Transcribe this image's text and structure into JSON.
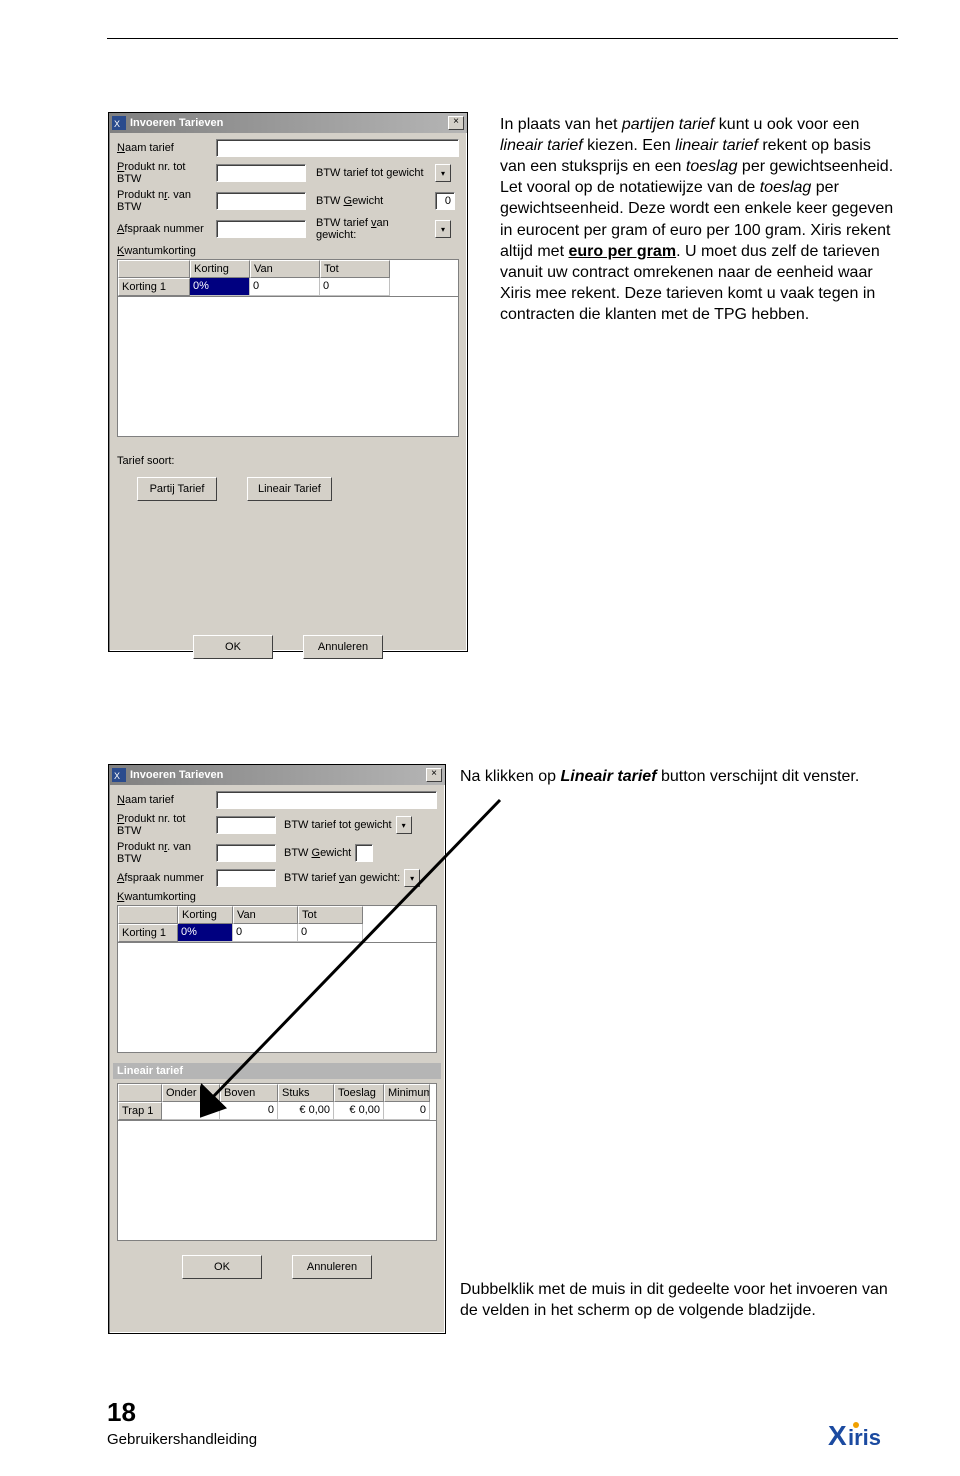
{
  "page": {
    "number": "18",
    "footer": "Gebruikershandleiding"
  },
  "paragraphs": {
    "p1_a": "In plaats van het ",
    "p1_b": "partijen tarief",
    "p1_c": " kunt u ook voor een ",
    "p1_d": "lineair tarief",
    "p1_e": " kiezen. Een ",
    "p1_f": "lineair tarief",
    "p1_g": " rekent op basis van een stuksprijs en een ",
    "p1_h": "toeslag",
    "p1_i": " per gewichtseenheid. Let vooral op de notatiewijze van de ",
    "p1_j": "toeslag",
    "p1_k": " per gewichtseenheid. Deze wordt een enkele keer gegeven in eurocent per gram of euro per 100 gram. Xiris rekent altijd met ",
    "p1_l": "euro per gram",
    "p1_m": ". U moet dus zelf de tarieven vanuit uw contract omrekenen naar de eenheid waar Xiris mee rekent. Deze tarieven komt u vaak tegen in contracten die klanten met de TPG hebben.",
    "p2_a": "Na klikken op ",
    "p2_b": "Lineair tarief",
    "p2_c": " button verschijnt dit venster.",
    "p3": "Dubbelklik met de muis in dit gedeelte voor het invoeren van de velden in het scherm op de volgende bladzijde."
  },
  "dialog": {
    "title": "Invoeren Tarieven",
    "labels": {
      "naam": "Naam tarief",
      "prod_tot": "Produkt nr. tot BTW",
      "btw_tot_gewicht": "BTW tarief tot gewicht",
      "prod_van": "Produkt nr. van BTW",
      "btw_gewicht": "BTW  Gewicht",
      "btw_gewicht_val": "0",
      "afspraak": "Afspraak nummer",
      "btw_van_gewicht": "BTW tarief van gewicht:",
      "kwantum": "Kwantumkorting",
      "tarief_soort": "Tarief soort:",
      "lineair_section": "Lineair tarief"
    },
    "korting": {
      "headers": [
        "",
        "Korting",
        "Van",
        "Tot"
      ],
      "row_label": "Korting 1",
      "cells": [
        "0%",
        "0",
        "0"
      ]
    },
    "lineair": {
      "headers": [
        "",
        "Onder Gew.",
        "Boven Gew.",
        "Stuks Prijs",
        "Toeslag",
        "Minimum"
      ],
      "row_label": "Trap 1",
      "cells": [
        "0",
        "0",
        "€      0,00",
        "€      0,00",
        "0"
      ]
    },
    "buttons": {
      "partij": "Partij Tarief",
      "lineair": "Lineair Tarief",
      "ok": "OK",
      "annuleer": "Annuleren"
    }
  },
  "logo": {
    "text": "iris"
  }
}
